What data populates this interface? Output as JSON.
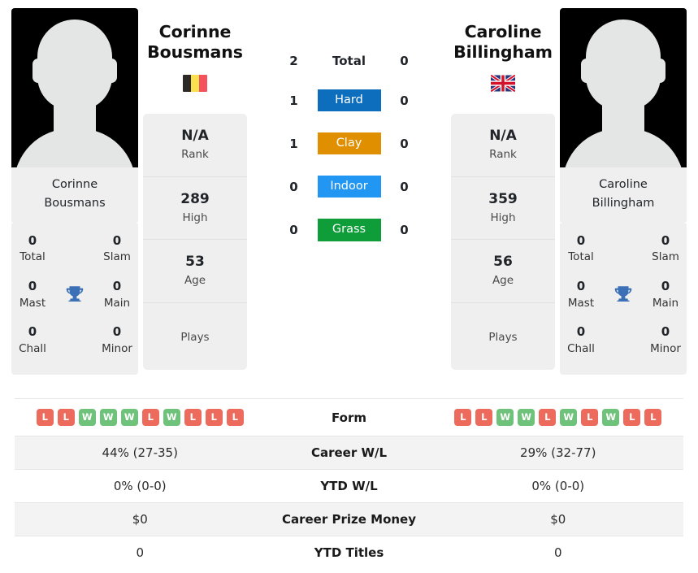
{
  "players": {
    "left": {
      "first_name": "Corinne",
      "last_name": "Bousmans",
      "full_name": "Corinne Bousmans",
      "country": "Belgium",
      "flag_icon": "flag-belgium-icon",
      "avatar_caption_line1": "Corinne",
      "avatar_caption_line2": "Bousmans",
      "titles": {
        "total_value": "0",
        "total_label": "Total",
        "slam_value": "0",
        "slam_label": "Slam",
        "mast_value": "0",
        "mast_label": "Mast",
        "main_value": "0",
        "main_label": "Main",
        "chall_value": "0",
        "chall_label": "Chall",
        "minor_value": "0",
        "minor_label": "Minor",
        "trophy_icon": "trophy-icon"
      },
      "card": [
        {
          "value": "N/A",
          "label": "Rank"
        },
        {
          "value": "289",
          "label": "High"
        },
        {
          "value": "53",
          "label": "Age"
        },
        {
          "value": "",
          "label": "Plays"
        }
      ],
      "form": [
        "L",
        "L",
        "W",
        "W",
        "W",
        "L",
        "W",
        "L",
        "L",
        "L"
      ],
      "career_wl": "44% (27-35)",
      "ytd_wl": "0% (0-0)",
      "career_prize_money": "$0",
      "ytd_titles": "0"
    },
    "right": {
      "first_name": "Caroline",
      "last_name": "Billingham",
      "full_name": "Caroline Billingham",
      "country": "United Kingdom",
      "flag_icon": "flag-uk-icon",
      "avatar_caption_line1": "Caroline",
      "avatar_caption_line2": "Billingham",
      "titles": {
        "total_value": "0",
        "total_label": "Total",
        "slam_value": "0",
        "slam_label": "Slam",
        "mast_value": "0",
        "mast_label": "Mast",
        "main_value": "0",
        "main_label": "Main",
        "chall_value": "0",
        "chall_label": "Chall",
        "minor_value": "0",
        "minor_label": "Minor",
        "trophy_icon": "trophy-icon"
      },
      "card": [
        {
          "value": "N/A",
          "label": "Rank"
        },
        {
          "value": "359",
          "label": "High"
        },
        {
          "value": "56",
          "label": "Age"
        },
        {
          "value": "",
          "label": "Plays"
        }
      ],
      "form": [
        "L",
        "L",
        "W",
        "W",
        "L",
        "W",
        "L",
        "W",
        "L",
        "L"
      ],
      "career_wl": "29% (32-77)",
      "ytd_wl": "0% (0-0)",
      "career_prize_money": "$0",
      "ytd_titles": "0"
    }
  },
  "head_to_head": {
    "rows": [
      {
        "label": "Total",
        "left": "2",
        "right": "0",
        "badge": false,
        "color": ""
      },
      {
        "label": "Hard",
        "left": "1",
        "right": "0",
        "badge": true,
        "color": "#0d6ebd"
      },
      {
        "label": "Clay",
        "left": "1",
        "right": "0",
        "badge": true,
        "color": "#df8f00"
      },
      {
        "label": "Indoor",
        "left": "0",
        "right": "0",
        "badge": true,
        "color": "#2196f3"
      },
      {
        "label": "Grass",
        "left": "0",
        "right": "0",
        "badge": true,
        "color": "#0f9d3a"
      }
    ]
  },
  "comparison": {
    "rows": [
      {
        "label": "Form",
        "type": "form",
        "left": "",
        "right": "",
        "alt": false
      },
      {
        "label": "Career W/L",
        "type": "text",
        "left": "44% (27-35)",
        "right": "29% (32-77)",
        "alt": true
      },
      {
        "label": "YTD W/L",
        "type": "text",
        "left": "0% (0-0)",
        "right": "0% (0-0)",
        "alt": false
      },
      {
        "label": "Career Prize Money",
        "type": "text",
        "left": "$0",
        "right": "$0",
        "alt": true
      },
      {
        "label": "YTD Titles",
        "type": "text",
        "left": "0",
        "right": "0",
        "alt": false
      }
    ]
  },
  "colors": {
    "win": "#6fc27a",
    "loss": "#ec6b5c",
    "hard": "#0d6ebd",
    "clay": "#df8f00",
    "indoor": "#2196f3",
    "grass": "#0f9d3a",
    "trophy": "#3b6fb6",
    "card_bg": "#efefef",
    "row_alt_bg": "#f3f3f3"
  }
}
